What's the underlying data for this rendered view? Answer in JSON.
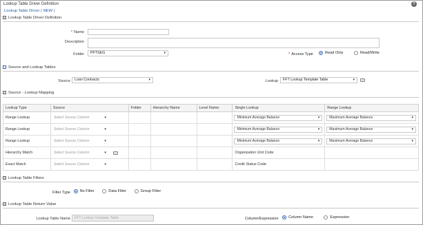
{
  "header": {
    "title": "Lookup Table Driver Definition",
    "breadcrumb": "Lookup Table Driver ( NEW )",
    "help_icon": "?"
  },
  "definition": {
    "section_title": "Lookup Table Driver Definition",
    "name_label": "Name",
    "name_value": "",
    "description_label": "Description",
    "description_value": "",
    "folder_label": "Folder",
    "folder_value": "PFTSEG",
    "access_type_label": "Access Type",
    "access_options": [
      {
        "label": "Read Only",
        "selected": true
      },
      {
        "label": "Read/Write",
        "selected": false
      }
    ]
  },
  "source_lookup": {
    "section_title": "Source and Lookup Tables",
    "source_label": "Source",
    "source_value": "Loan Contracts",
    "lookup_label": "Lookup",
    "lookup_value": "FFT Lookup Template Table"
  },
  "mapping": {
    "section_title": "Source - Lookup Mapping",
    "columns": [
      "Lookup Type",
      "Source",
      "Folder",
      "Hierarchy Name",
      "Level Name",
      "Single Lookup",
      "Range Lookup"
    ],
    "placeholder": "Select Source Column",
    "rows": [
      {
        "type": "Range Lookup",
        "single": "Minimum Average Balance",
        "range": "Maximum Average Balance"
      },
      {
        "type": "Range Lookup",
        "single": "Minimum Average Balance",
        "range": "Maximum Average Balance"
      },
      {
        "type": "Range Lookup",
        "single": "Minimum Average Balance",
        "range": "Maximum Average Balance"
      },
      {
        "type": "Hierarchy Match",
        "single": "Organization Unit Code",
        "range": ""
      },
      {
        "type": "Exact Match",
        "single": "Credit Status Code",
        "range": ""
      }
    ]
  },
  "filters": {
    "section_title": "Lookup Table Filters",
    "filter_type_label": "Filter Type",
    "options": [
      {
        "label": "No Filter",
        "selected": true
      },
      {
        "label": "Data Filter",
        "selected": false
      },
      {
        "label": "Group Filter",
        "selected": false
      }
    ]
  },
  "return_value": {
    "section_title": "Lookup Table Return Value",
    "table_name_label": "Lookup Table Name",
    "table_name_value": "FFT Lookup Template Table",
    "col_expr_label": "Column/Expression",
    "options": [
      {
        "label": "Column Name",
        "selected": true
      },
      {
        "label": "Expression",
        "selected": false
      }
    ]
  }
}
